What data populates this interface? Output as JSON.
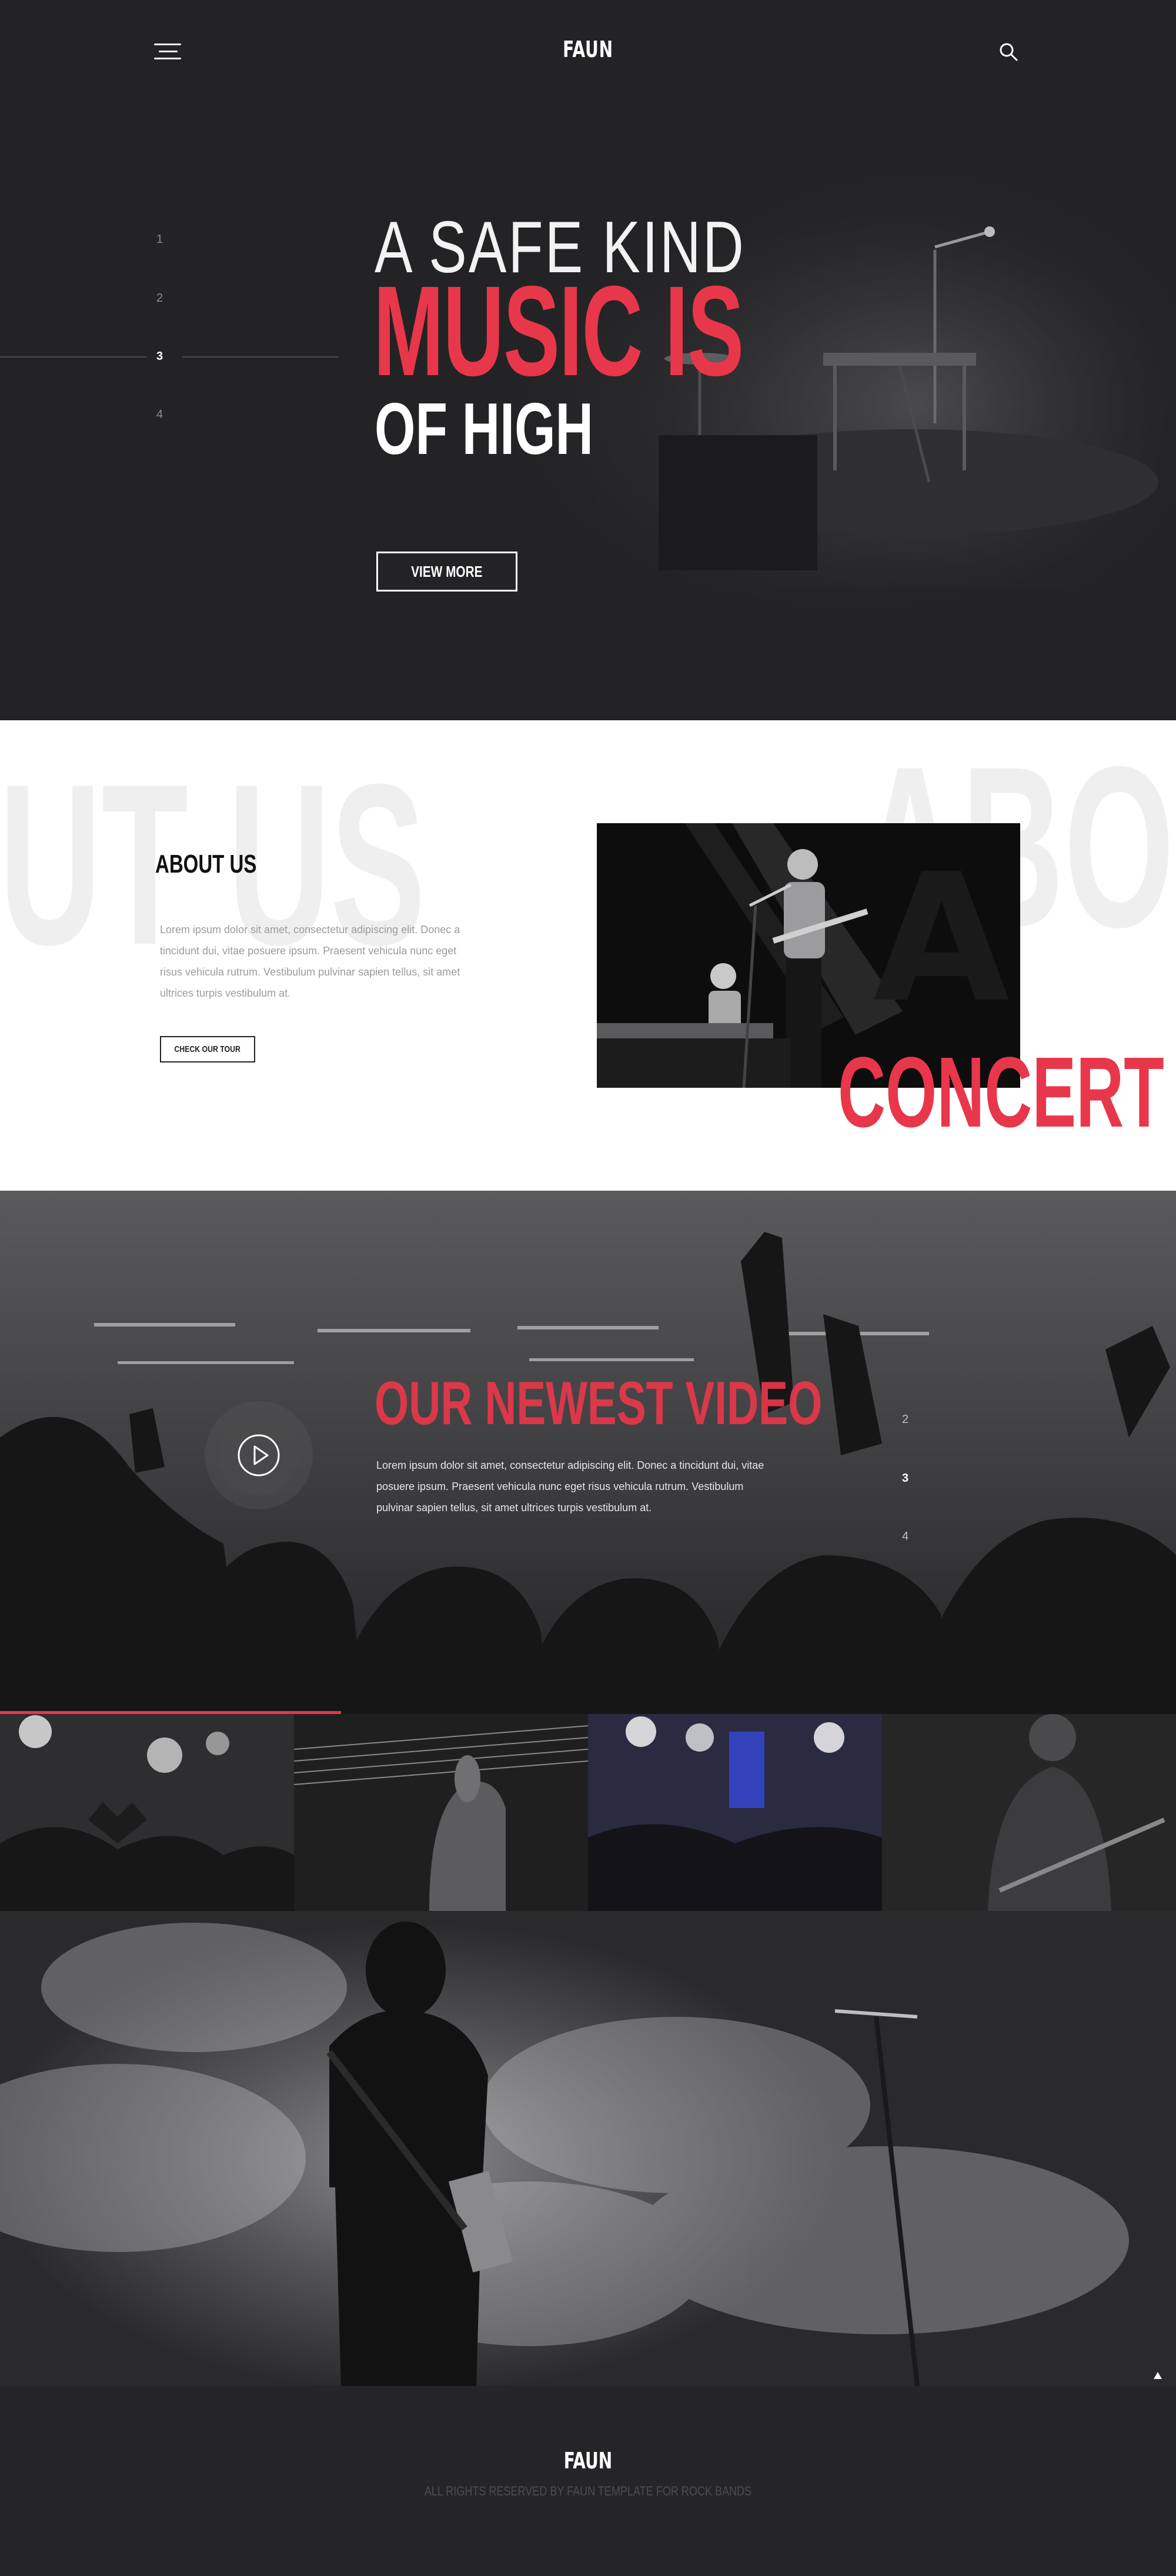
{
  "header": {
    "brand": "FAUN"
  },
  "hero": {
    "line1": "A SAFE KIND",
    "line2": "MUSIC IS",
    "line3": "OF HIGH",
    "button": "VIEW MORE",
    "slides": [
      "1",
      "2",
      "3",
      "4"
    ],
    "active_slide": "3"
  },
  "about": {
    "ghost_left": "OUT US",
    "ghost_right": "ABO",
    "title": "ABOUT US",
    "text": "Lorem ipsum dolor sit amet, consectetur adipiscing elit. Donec a tincidunt dui, vitae posuere ipsum. Praesent vehicula nunc eget risus vehicula rutrum. Vestibulum pulvinar sapien tellus, sit amet ultrices turpis vestibulum at.",
    "button": "CHECK OUR TOUR",
    "overlay": "CONCERT"
  },
  "video": {
    "title": "OUR NEWEST VIDEO",
    "text": "Lorem ipsum dolor sit amet, consectetur adipiscing elit. Donec a tincidunt dui, vitae posuere ipsum. Praesent vehicula nunc eget risus vehicula rutrum. Vestibulum pulvinar sapien tellus, sit amet ultrices turpis vestibulum at.",
    "slides": [
      "2",
      "3",
      "4"
    ],
    "active_slide": "3"
  },
  "footer": {
    "brand": "FAUN",
    "copyright": "ALL RIGHTS RESERVED BY FAUN TEMPLATE FOR ROCK BANDS"
  },
  "colors": {
    "accent": "#e8374a",
    "dark": "#232325"
  }
}
